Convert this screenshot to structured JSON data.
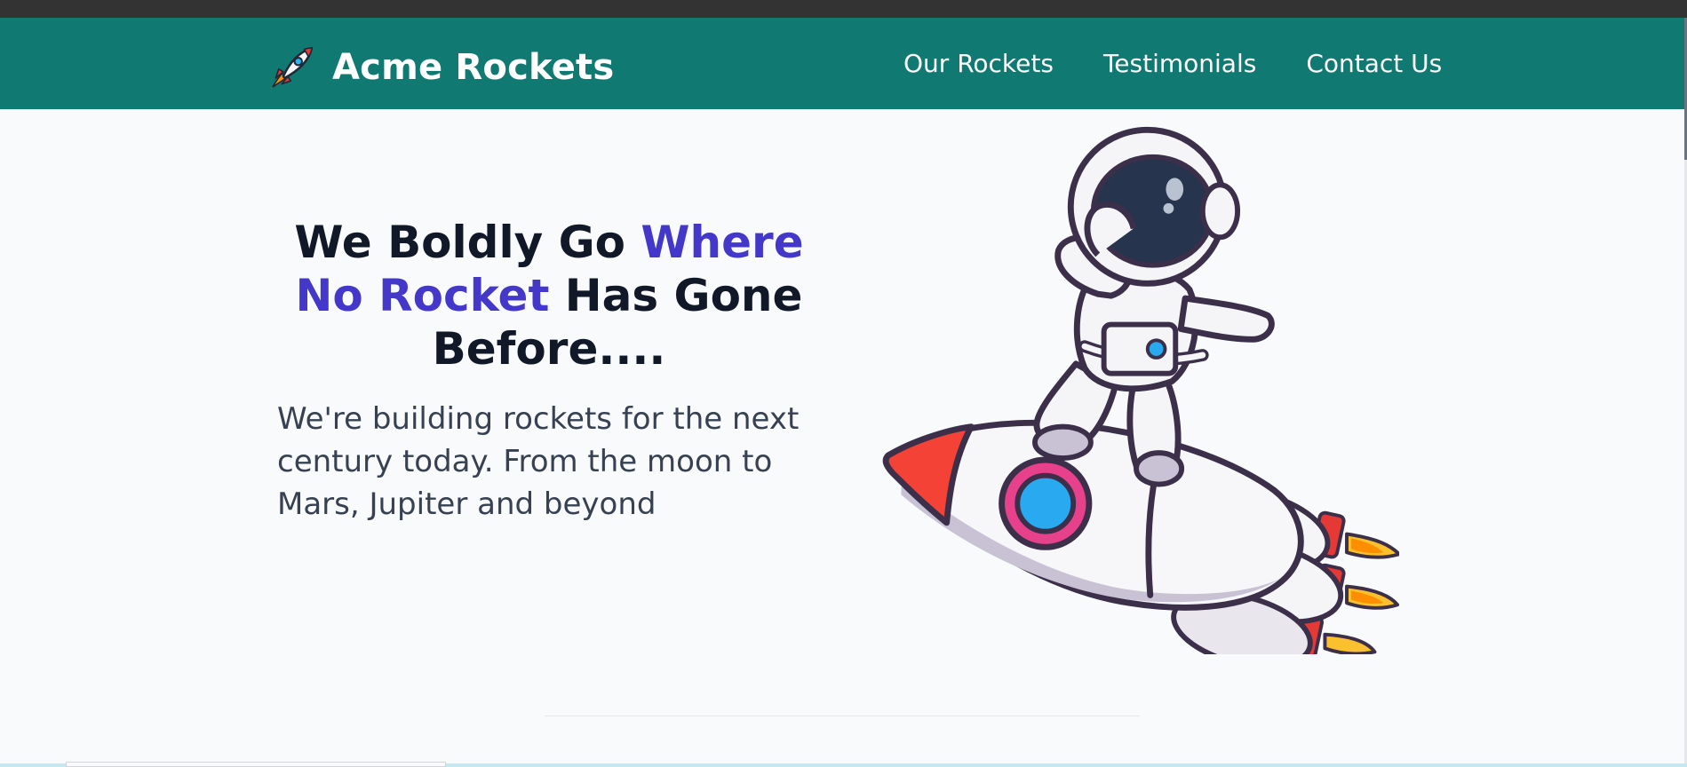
{
  "header": {
    "brand_name": "Acme Rockets",
    "logo_icon": "rocket-icon",
    "nav": [
      {
        "label": "Our Rockets"
      },
      {
        "label": "Testimonials"
      },
      {
        "label": "Contact Us"
      }
    ]
  },
  "hero": {
    "title_part1": "We Boldly Go ",
    "title_highlight": "Where No Rocket",
    "title_part2": " Has Gone Before....",
    "subtitle": "We're building rockets for the next century today. From the moon to Mars, Jupiter and beyond",
    "image": "astronaut-riding-rocket-illustration"
  },
  "colors": {
    "header_bg": "#107a72",
    "page_bg": "#f8fafc",
    "accent": "#4338ca",
    "heading": "#111827",
    "body_text": "#374151"
  }
}
